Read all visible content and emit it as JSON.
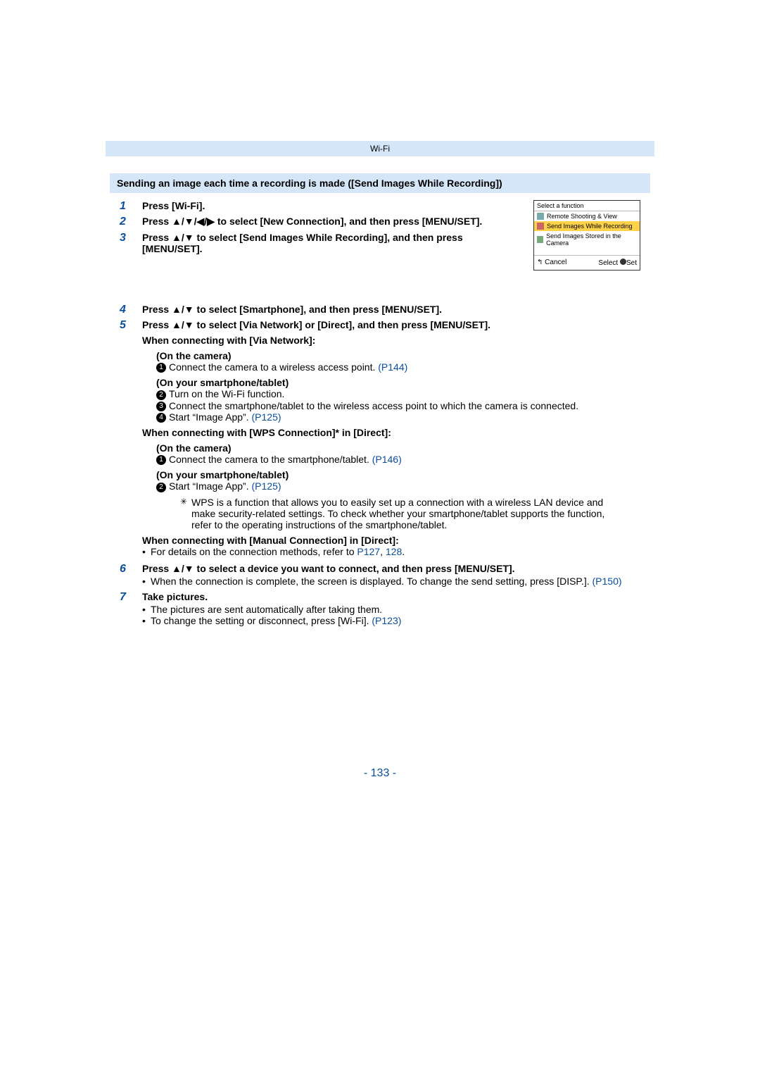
{
  "header": {
    "label": "Wi-Fi"
  },
  "sectionTitle": "Sending an image each time a recording is made ([Send Images While Recording])",
  "steps": {
    "s1": {
      "text": "Press [Wi-Fi]."
    },
    "s2": {
      "text": "Press ▲/▼/◀/▶ to select [New Connection], and then press [MENU/SET]."
    },
    "s3": {
      "text": "Press ▲/▼ to select [Send Images While Recording], and then press [MENU/SET]."
    },
    "s4": {
      "text": "Press ▲/▼ to select [Smartphone], and then press [MENU/SET]."
    },
    "s5": {
      "text": "Press ▲/▼ to select [Via Network] or [Direct], and then press [MENU/SET].",
      "viaNetwork": {
        "heading": "When connecting with [Via Network]:",
        "camHead": "(On the camera)",
        "cam1_a": "Connect the camera to a wireless access point. ",
        "cam1_b": "(P144)",
        "phoneHead": "(On your smartphone/tablet)",
        "p2": "Turn on the Wi-Fi function.",
        "p3": "Connect the smartphone/tablet to the wireless access point to which the camera is connected.",
        "p4_a": "Start “Image App”. ",
        "p4_b": "(P125)"
      },
      "wps": {
        "heading": "When connecting with [WPS Connection]* in [Direct]:",
        "camHead": "(On the camera)",
        "cam1_a": "Connect the camera to the smartphone/tablet. ",
        "cam1_b": "(P146)",
        "phoneHead": "(On your smartphone/tablet)",
        "p2_a": "Start “Image App”. ",
        "p2_b": "(P125)",
        "foot": "WPS is a function that allows you to easily set up a connection with a wireless LAN device and make security-related settings. To check whether your smartphone/tablet supports the function, refer to the operating instructions of the smartphone/tablet."
      },
      "manual": {
        "heading": "When connecting with [Manual Connection] in [Direct]:",
        "line_a": "For details on the connection methods, refer to ",
        "line_b": "P127",
        "line_c": ", ",
        "line_d": "128",
        "line_e": "."
      }
    },
    "s6": {
      "text": "Press ▲/▼ to select a device you want to connect, and then press [MENU/SET].",
      "note_a": "When the connection is complete, the screen is displayed. To change the send setting, press [DISP.]. ",
      "note_b": "(P150)"
    },
    "s7": {
      "text": "Take pictures.",
      "b1": "The pictures are sent automatically after taking them.",
      "b2_a": "To change the setting or disconnect, press [Wi-Fi]. ",
      "b2_b": "(P123)"
    }
  },
  "cameraScreen": {
    "title": "Select a function",
    "opt1": "Remote Shooting & View",
    "opt2": "Send Images While Recording",
    "opt3": "Send Images Stored in the Camera",
    "cancel": "Cancel",
    "select": "Select",
    "set": "Set"
  },
  "pageNumber": "- 133 -"
}
